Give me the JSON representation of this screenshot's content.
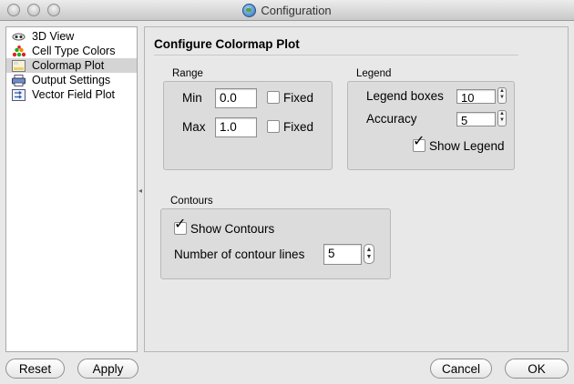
{
  "window": {
    "title": "Configuration"
  },
  "sidebar": {
    "items": [
      {
        "label": "3D View",
        "icon": "eye-icon"
      },
      {
        "label": "Cell Type Colors",
        "icon": "color-dots-icon"
      },
      {
        "label": "Colormap Plot",
        "icon": "colormap-icon",
        "selected": true
      },
      {
        "label": "Output Settings",
        "icon": "printer-icon"
      },
      {
        "label": "Vector Field Plot",
        "icon": "vector-field-icon"
      }
    ]
  },
  "main": {
    "heading": "Configure Colormap Plot",
    "range": {
      "title": "Range",
      "min_label": "Min",
      "min_value": "0.0",
      "min_fixed_label": "Fixed",
      "min_fixed_checked": false,
      "max_label": "Max",
      "max_value": "1.0",
      "max_fixed_label": "Fixed",
      "max_fixed_checked": false
    },
    "legend": {
      "title": "Legend",
      "boxes_label": "Legend boxes",
      "boxes_value": "10",
      "accuracy_label": "Accuracy",
      "accuracy_value": "5",
      "show_legend_label": "Show Legend",
      "show_legend_checked": true
    },
    "contours": {
      "title": "Contours",
      "show_label": "Show Contours",
      "show_checked": true,
      "lines_label": "Number of contour lines",
      "lines_value": "5"
    }
  },
  "buttons": {
    "reset": "Reset",
    "apply": "Apply",
    "cancel": "Cancel",
    "ok": "OK"
  },
  "glyphs": {
    "check": "✓",
    "up": "▲",
    "down": "▼",
    "splitter": "◂"
  }
}
